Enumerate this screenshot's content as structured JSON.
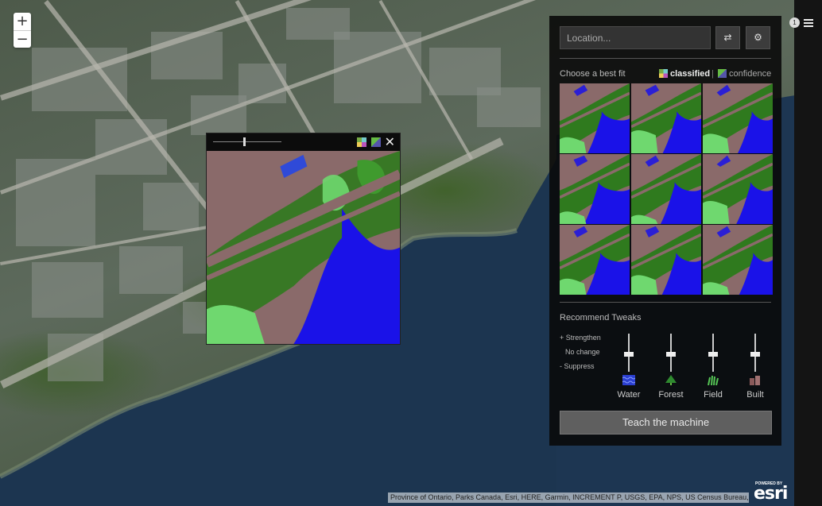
{
  "map": {
    "zoom_in_label": "+",
    "zoom_out_label": "−",
    "attribution": "Province of Ontario, Parks Canada, Esri, HERE, Garmin, INCREMENT P, USGS, EPA, NPS, US Census Bureau, USDA",
    "powered_by": "POWERED BY",
    "brand": "esri"
  },
  "preview": {
    "close_label": "✕",
    "opacity_fraction": 0.45
  },
  "panel": {
    "location_placeholder": "Location...",
    "choose_label": "Choose a best fit",
    "mode_classified": "classified",
    "mode_separator": "|",
    "mode_confidence": "confidence",
    "tweaks_title": "Recommend Tweaks",
    "scale": [
      "+ Strengthen",
      "No change",
      "-  Suppress"
    ],
    "tweaks": [
      {
        "label": "Water",
        "icon": "water-icon",
        "color": "#2b3fd0"
      },
      {
        "label": "Forest",
        "icon": "forest-icon",
        "color": "#2f8a2f"
      },
      {
        "label": "Field",
        "icon": "field-icon",
        "color": "#55c455"
      },
      {
        "label": "Built",
        "icon": "built-icon",
        "color": "#8a5a5a"
      }
    ],
    "teach_label": "Teach the machine"
  },
  "classes": {
    "water": "#1a12e8",
    "forest": "#2f7a1e",
    "field": "#6fd86f",
    "built": "#8a6a6a"
  },
  "notification_count": "1"
}
